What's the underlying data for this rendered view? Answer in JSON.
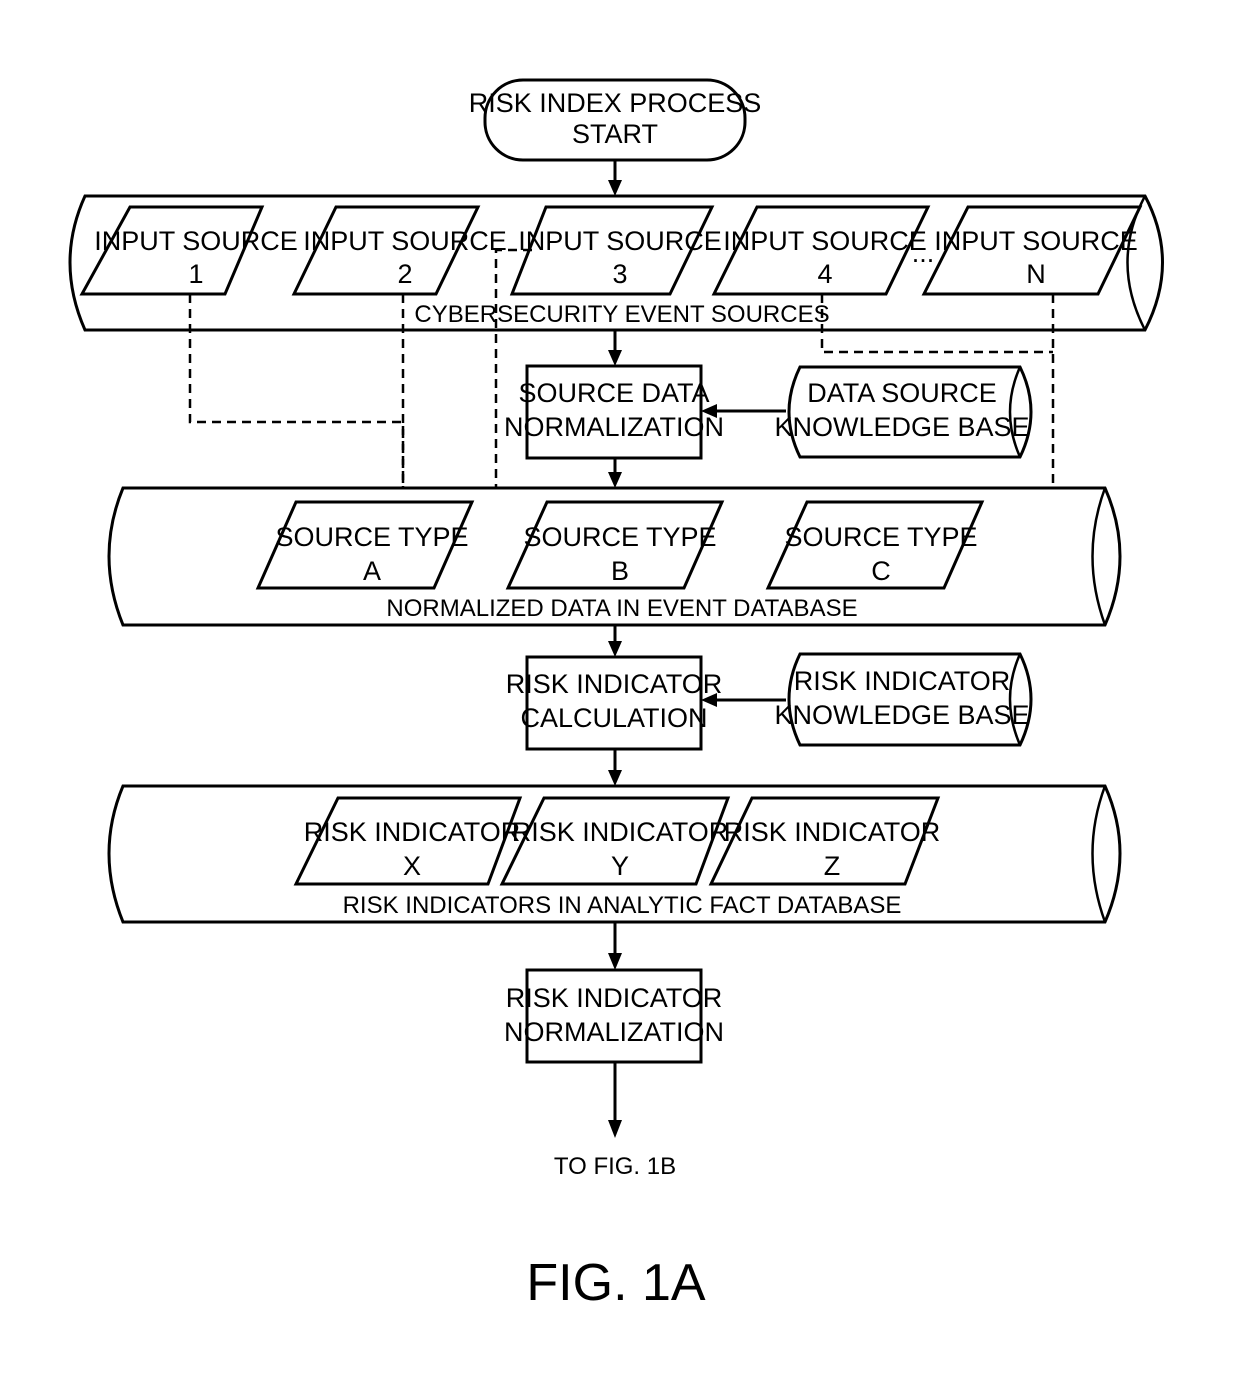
{
  "figure_label": "FIG. 1A",
  "start": {
    "line1": "RISK INDEX PROCESS",
    "line2": "START"
  },
  "event_sources_db": {
    "label": "CYBERSECURITY EVENT SOURCES",
    "inputs": [
      {
        "line1": "INPUT SOURCE",
        "line2": "1"
      },
      {
        "line1": "INPUT SOURCE",
        "line2": "2"
      },
      {
        "line1": "INPUT SOURCE",
        "line2": "3"
      },
      {
        "line1": "INPUT SOURCE",
        "line2": "4"
      },
      {
        "line1": "INPUT SOURCE",
        "line2": "N"
      }
    ],
    "ellipsis": "..."
  },
  "source_normalization": {
    "line1": "SOURCE DATA",
    "line2": "NORMALIZATION"
  },
  "data_source_kb": {
    "line1": "DATA SOURCE",
    "line2": "KNOWLEDGE BASE"
  },
  "event_db": {
    "label": "NORMALIZED DATA IN EVENT DATABASE",
    "types": [
      {
        "line1": "SOURCE TYPE",
        "line2": "A"
      },
      {
        "line1": "SOURCE TYPE",
        "line2": "B"
      },
      {
        "line1": "SOURCE TYPE",
        "line2": "C"
      }
    ]
  },
  "indicator_calc": {
    "line1": "RISK INDICATOR",
    "line2": "CALCULATION"
  },
  "indicator_kb": {
    "line1": "RISK INDICATOR",
    "line2": "KNOWLEDGE BASE"
  },
  "fact_db": {
    "label": "RISK INDICATORS IN ANALYTIC FACT DATABASE",
    "indicators": [
      {
        "line1": "RISK INDICATOR",
        "line2": "X"
      },
      {
        "line1": "RISK INDICATOR",
        "line2": "Y"
      },
      {
        "line1": "RISK INDICATOR",
        "line2": "Z"
      }
    ]
  },
  "indicator_norm": {
    "line1": "RISK INDICATOR",
    "line2": "NORMALIZATION"
  },
  "continuation": "TO FIG. 1B"
}
